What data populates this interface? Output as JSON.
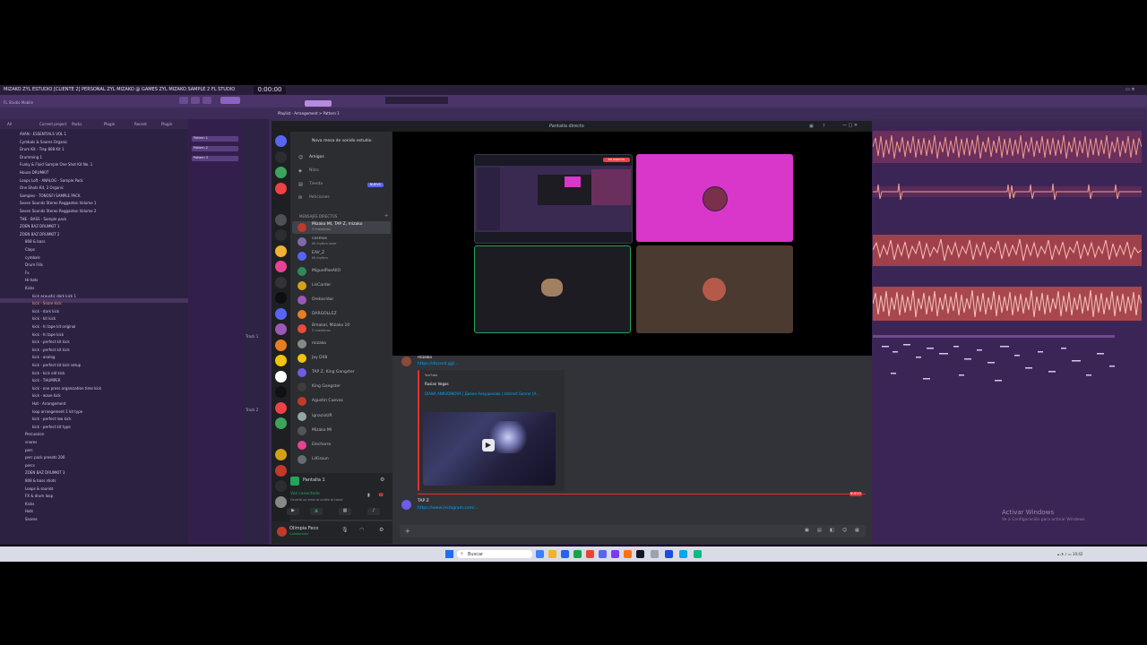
{
  "fl_studio": {
    "title": "MIZAKO ZYL ESTUDIO [CLIENTE 2] PERSONAL ZYL MIZAKO @ GAMES ZYL MIZAKO SAMPLE 2 FL STUDIO",
    "time_display": "0:00:00",
    "hint_text": "FL Studio Mobile",
    "playlist_label": "Playlist - Arrangement > Pattern 1",
    "browser_tabs": [
      "All",
      "Current project",
      "Packs",
      "Plugin",
      "Recent",
      "Plugin"
    ],
    "browser_items": [
      "AVAN - ESSENTIALS VOL 1",
      "Cymbals & Snares Organic",
      "Drum Kit - Trap 808 Kit 1",
      "Drumming 1",
      "Funky & Fluid Sample One Shot Kit No. 1",
      "House DRUMKIT",
      "Loops Loft - ANALOG - Sample Pack",
      "One Shots Kit, 2 Organic",
      "Samples - TONOSFI SAMPLE PACK",
      "Seven Sounds Stereo Reggaeton Volume 1",
      "Seven Sounds Stereo Reggaeton Volume 2",
      "THE - BASS - Sample pack",
      "ZOEN BAZ DRUMKIT 1",
      "ZOEN BAZ DRUMKIT 2",
      "808 & bass",
      "Claps",
      "cymbals",
      "Drum Fills",
      "Fx",
      "Hi-hats",
      "Kicks",
      "kick acoustic dark kick 1",
      "kick - Snare kick",
      "kick - dark kick",
      "kick - kit kick",
      "kick - hi tape kit original",
      "kick - hi tape kick",
      "kick - perfect kit kick",
      "kick - perfect kit kick",
      "kick - analog",
      "kick - perfect kit kick setup",
      "kick - kick old kick",
      "kick - THUMPER",
      "kick - one press organization time kick",
      "kick - wave kick",
      "Hat - Arrangement",
      "loop arrangement 1 kit type",
      "kick - perfect low kick",
      "kick - perfect kit type",
      "Percussion",
      "snares",
      "perc",
      "perc pack presets 200",
      "percs",
      "ZOEN BAZ DRUMKIT 3",
      "808 & bass shots",
      "Loops & sounds",
      "FX & drum loop",
      "Kicks",
      "Hats",
      "Snares"
    ],
    "selected_browser_index": 22,
    "channel_blocks": [
      "Pattern 1",
      "Pattern 2",
      "Pattern 3"
    ],
    "track_labels": [
      "Track 1",
      "Track 2"
    ],
    "activate_windows": {
      "title": "Activar Windows",
      "subtitle": "Ve a Configuración para activar Windows."
    }
  },
  "discord": {
    "window_title": "Pantalla directo",
    "server_name": "Nova mesa de sonido estudio",
    "top_channels": [
      "Amigos",
      "Nitro",
      "Tienda",
      "Peticiones"
    ],
    "nitro_badge": "NUEVO",
    "dm_header": "MENSAJES DIRECTOS",
    "dm_list": [
      {
        "name": "Mizako MI, TAP Z, mizako",
        "sub": "3 miembros",
        "color": "#c0392b"
      },
      {
        "name": "cosmos",
        "sub": "Mi rhythm lover",
        "color": "#7f6aa8"
      },
      {
        "name": "EAV_Z",
        "sub": "Mi rhythm",
        "color": "#5865f2"
      },
      {
        "name": "MiguelPaeAllO",
        "sub": "",
        "color": "#2e8b57"
      },
      {
        "name": "LisCardor",
        "sub": "",
        "color": "#d4a017"
      },
      {
        "name": "Orebaridor",
        "sub": "",
        "color": "#9b59b6"
      },
      {
        "name": "DARGOLLEZ",
        "sub": "",
        "color": "#e67e22"
      },
      {
        "name": "Bmakal, Mizako 10",
        "sub": "3 miembros",
        "color": "#e74c3c"
      },
      {
        "name": "mizako",
        "sub": "",
        "color": "#888888"
      },
      {
        "name": "Jay D08",
        "sub": "",
        "color": "#f1c40f"
      },
      {
        "name": "TAP Z, King Gangster",
        "sub": "",
        "color": "#6c5ce7"
      },
      {
        "name": "King Gangster",
        "sub": "",
        "color": "#3d3d3d"
      },
      {
        "name": "Agustin Cuevas",
        "sub": "",
        "color": "#c0392b"
      },
      {
        "name": "ignacioUR",
        "sub": "",
        "color": "#95a5a6"
      },
      {
        "name": "Mizako MI",
        "sub": "",
        "color": "#555555"
      },
      {
        "name": "Elechorro",
        "sub": "",
        "color": "#e84393"
      },
      {
        "name": "LilGroun",
        "sub": "",
        "color": "#636e72"
      }
    ],
    "voice": {
      "channel": "Pantalla 1",
      "status": "Voz conectada",
      "sub": "Ocurrió un error al unirte al canal"
    },
    "user": {
      "name": "Olimpia Feco",
      "status": "Colaborador"
    },
    "live_badge": "EN DIRECTO",
    "chat": {
      "author": "mizako",
      "link": "https://discord.gg/...",
      "embed_site": "YouTube",
      "embed_author": "Rusian Vegas",
      "embed_title": "DIANA ANKUDINOVA | Диана Анкудинова | Inktrest Genrer (A...",
      "second_author": "TAP Z",
      "second_link": "https://www.instagram.com/...",
      "new_badge": "NUEVO"
    },
    "colors": {
      "accent": "#5865f2",
      "danger": "#e23030",
      "online": "#23a55a",
      "tile_pink": "#d837c9",
      "tile_brown": "#4a3a30"
    }
  },
  "taskbar": {
    "search": "Buscar",
    "tray_time": "10:42"
  }
}
